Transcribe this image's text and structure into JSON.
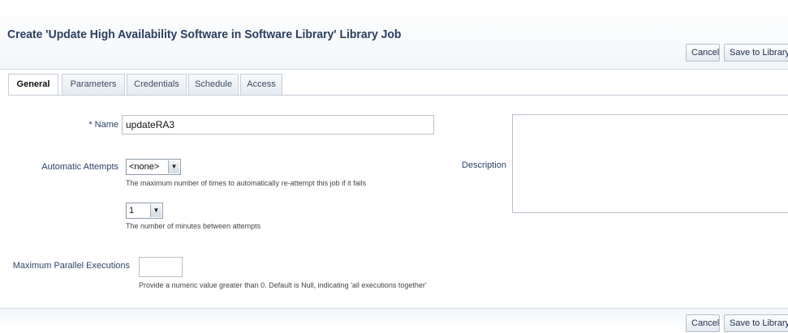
{
  "header": {
    "title": "Create 'Update High Availability Software in Software Library' Library Job",
    "cancel_label": "Cancel",
    "save_label": "Save to Library"
  },
  "tabs": [
    {
      "label": "General",
      "active": true
    },
    {
      "label": "Parameters",
      "active": false
    },
    {
      "label": "Credentials",
      "active": false
    },
    {
      "label": "Schedule",
      "active": false
    },
    {
      "label": "Access",
      "active": false
    }
  ],
  "form": {
    "name": {
      "required_marker": "*",
      "label": "Name",
      "value": "updateRA3"
    },
    "automatic_attempts": {
      "label": "Automatic Attempts",
      "selected": "<none>",
      "hint": "The maximum number of times to automatically re-attempt this job if it fails"
    },
    "minutes_between": {
      "selected": "1",
      "hint": "The number of minutes between attempts"
    },
    "max_parallel": {
      "label": "Maximum Parallel Executions",
      "value": "",
      "hint": "Provide a numeric value greater than 0. Default is Null, indicating 'all executions together'"
    },
    "description": {
      "label": "Description",
      "value": ""
    }
  },
  "footer": {
    "cancel_label": "Cancel",
    "save_label": "Save to Library"
  },
  "icons": {
    "select_arrow": "chevron-down-icon"
  }
}
